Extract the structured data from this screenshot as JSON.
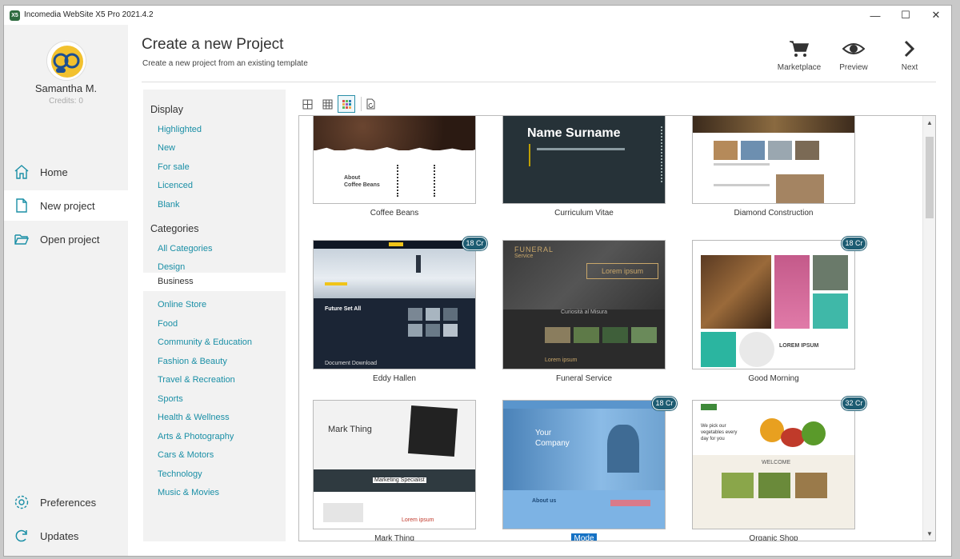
{
  "window": {
    "title": "Incomedia WebSite X5 Pro 2021.4.2",
    "icon_label": "X5"
  },
  "window_controls": {
    "minimize": "—",
    "maximize": "☐",
    "close": "✕"
  },
  "user": {
    "name": "Samantha M.",
    "credits": "Credits: 0"
  },
  "nav": {
    "home": "Home",
    "new_project": "New project",
    "open_project": "Open project",
    "preferences": "Preferences",
    "updates": "Updates"
  },
  "header": {
    "title": "Create a new Project",
    "subtitle": "Create a new project from an existing template",
    "marketplace": "Marketplace",
    "preview": "Preview",
    "next": "Next"
  },
  "filters": {
    "display_heading": "Display",
    "display_items": [
      "Highlighted",
      "New",
      "For sale",
      "Licenced",
      "Blank"
    ],
    "categories_heading": "Categories",
    "category_items": [
      "All Categories",
      "Design",
      "Business",
      "Online Store",
      "Food",
      "Community & Education",
      "Fashion & Beauty",
      "Travel & Recreation",
      "Sports",
      "Health & Wellness",
      "Arts & Photography",
      "Cars & Motors",
      "Technology",
      "Music & Movies"
    ],
    "selected_category": "Business"
  },
  "templates": [
    {
      "name": "Coffee Beans",
      "badge": ""
    },
    {
      "name": "Curriculum Vitae",
      "badge": ""
    },
    {
      "name": "Diamond Construction",
      "badge": ""
    },
    {
      "name": "Eddy Hallen",
      "badge": "18 Cr"
    },
    {
      "name": "Funeral Service",
      "badge": ""
    },
    {
      "name": "Good Morning",
      "badge": "18 Cr"
    },
    {
      "name": "Mark Thing",
      "badge": ""
    },
    {
      "name": "Mode",
      "badge": "18 Cr",
      "selected": true
    },
    {
      "name": "Organic Shop",
      "badge": "32 Cr"
    }
  ],
  "thumb_text": {
    "coffee_heading": "About\nCoffee Beans",
    "cv_name": "Name Surname",
    "funeral_logo": "FUNERAL",
    "funeral_sub": "Service",
    "funeral_caption": "Lorem ipsum",
    "funeral_band": "Curiosità al Misura",
    "funeral_footer": "Lorem ipsum",
    "eddy_section": "Future Set All",
    "eddy_footer": "Document Download",
    "goodmorning_side": "LOREM IPSUM",
    "mark_name": "Mark Thing",
    "mark_role": "Marketing Specialist",
    "mark_lorem": "Lorem ipsum",
    "mode_heading": "Your\nCompany",
    "mode_about": "About us",
    "organic_heading": "We pick our\nvegetables every\nday for you",
    "organic_welcome": "WELCOME"
  },
  "colors": {
    "accent": "#1a8fa6",
    "badge": "#1d5c72",
    "selection": "#1672c4",
    "sidebar_bg": "#f2f2f2"
  }
}
